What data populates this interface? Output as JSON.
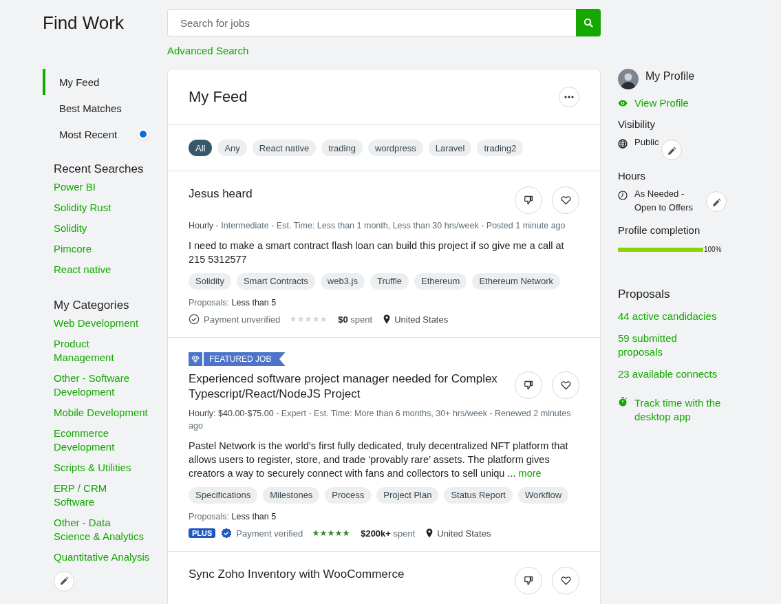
{
  "header": {
    "title": "Find Work",
    "search": {
      "placeholder": "Search for jobs"
    },
    "advanced_search": "Advanced Search"
  },
  "sidebar": {
    "nav": [
      {
        "label": "My Feed",
        "selected": true,
        "indicator": false
      },
      {
        "label": "Best Matches",
        "selected": false,
        "indicator": false
      },
      {
        "label": "Most Recent",
        "selected": false,
        "indicator": true
      }
    ],
    "recent_searches": {
      "title": "Recent Searches",
      "items": [
        "Power BI",
        "Solidity Rust",
        "Solidity",
        "Pimcore",
        "React native"
      ]
    },
    "categories": {
      "title": "My Categories",
      "items": [
        "Web Development",
        "Product Management",
        "Other - Software Development",
        "Mobile Development",
        "Ecommerce Development",
        "Scripts & Utilities",
        "ERP / CRM Software",
        "Other - Data Science & Analytics",
        "Quantitative Analysis"
      ]
    }
  },
  "feed": {
    "title": "My Feed",
    "filters": [
      {
        "label": "All",
        "selected": true
      },
      {
        "label": "Any",
        "selected": false
      },
      {
        "label": "React native",
        "selected": false
      },
      {
        "label": "trading",
        "selected": false
      },
      {
        "label": "wordpress",
        "selected": false
      },
      {
        "label": "Laravel",
        "selected": false
      },
      {
        "label": "trading2",
        "selected": false
      }
    ],
    "jobs": [
      {
        "featured": false,
        "title": "Jesus heard",
        "meta": "**Hourly** - Intermediate - Est. Time: Less than 1 month, Less than 30 hrs/week - Posted 1 minute ago",
        "description": "I need to make a smart contract flash loan can build this project if so give me a call at 215 5312577",
        "skills": [
          "Solidity",
          "Smart Contracts",
          "web3.js",
          "Truffle",
          "Ethereum",
          "Ethereum Network"
        ],
        "proposals": "Proposals: **Less than 5**",
        "plus": false,
        "payment_verified": false,
        "payment": "Payment unverified",
        "stars": 0,
        "spent": "**$0** spent",
        "location": "United States"
      },
      {
        "featured": true,
        "featured_label": "FEATURED JOB",
        "title": "Experienced software project manager needed for Complex Typescript/React/NodeJS Project",
        "meta": "**Hourly: $40.00-$75.00** - Expert - Est. Time: More than 6 months, 30+ hrs/week - Renewed 2 minutes ago",
        "description": "Pastel Network is the world’s first fully dedicated, truly decentralized NFT platform that allows users to register, store, and trade ‘provably rare’ assets. The platform gives creators a way to securely connect with fans and collectors to sell uniqu ...",
        "more": "more",
        "skills": [
          "Specifications",
          "Milestones",
          "Process",
          "Project Plan",
          "Status Report",
          "Workflow"
        ],
        "proposals": "Proposals: **Less than 5**",
        "plus": true,
        "plus_label": "PLUS",
        "payment_verified": true,
        "payment": "Payment verified",
        "stars": 5,
        "spent": "**$200k+** spent",
        "location": "United States"
      },
      {
        "featured": false,
        "title": "Sync Zoho Inventory with WooCommerce"
      }
    ]
  },
  "profile": {
    "title": "My Profile",
    "view_profile": "View Profile",
    "visibility": {
      "title": "Visibility",
      "value": "Public"
    },
    "hours": {
      "title": "Hours",
      "value": "As Needed - Open to Offers"
    },
    "completion": {
      "title": "Profile completion",
      "level": 1.0,
      "reading": "100%"
    },
    "proposals": {
      "title": "Proposals",
      "links": [
        "44 active candidacies",
        "59 submitted proposals",
        "23 available connects"
      ]
    },
    "track_time": "Track time with the desktop app"
  }
}
